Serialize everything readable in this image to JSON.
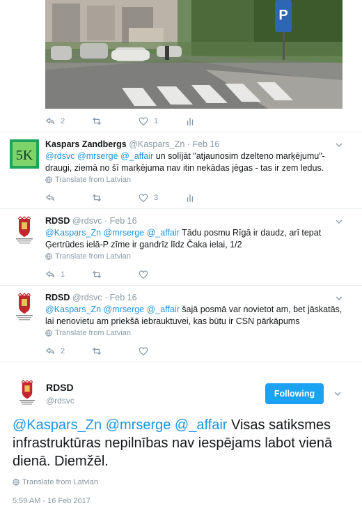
{
  "photo_tweet": {
    "reply_count": "2",
    "retweet_count": "",
    "like_count": "1"
  },
  "replies": [
    {
      "name": "Kaspars Zandbergs",
      "handle": "@Kaspars_Zn",
      "dot": "·",
      "time": "Feb 16",
      "mentions": [
        "@rdsvc",
        "@mrserge",
        "@_affair"
      ],
      "text": " un solījāt \"atjaunosim dzelteno marķējumu\"-draugi, ziemā no šī marķējuma nav itin nekādas jēgas - tas ir zem ledus.",
      "translate": "Translate from Latvian",
      "reply_count": "",
      "retweet_count": "",
      "like_count": "3",
      "avatar_text": "5K"
    },
    {
      "name": "RDSD",
      "handle": "@rdsvc",
      "dot": "·",
      "time": "Feb 16",
      "mentions": [
        "@Kaspars_Zn",
        "@mrserge",
        "@_affair"
      ],
      "text": " Tādu posmu Rīgā ir daudz, arī tepat Ģertrūdes ielā-P zīme ir gandrīz līdz Čaka ielai, 1/2",
      "translate": "Translate from Latvian",
      "reply_count": "1",
      "retweet_count": "",
      "like_count": ""
    },
    {
      "name": "RDSD",
      "handle": "@rdsvc",
      "dot": "·",
      "time": "Feb 16",
      "mentions": [
        "@Kaspars_Zn",
        "@mrserge",
        "@_affair"
      ],
      "text": "  šajā posmā var novietot am, bet jāskatās, lai nenovietu am priekšā iebrauktuvei, kas būtu ir CSN pārkāpums",
      "translate": "Translate from Latvian",
      "reply_count": "2",
      "retweet_count": "",
      "like_count": ""
    }
  ],
  "main_tweet": {
    "name": "RDSD",
    "handle": "@rdsvc",
    "follow_label": "Following",
    "mentions": [
      "@Kaspars_Zn",
      "@mrserge",
      "@_affair"
    ],
    "text": " Visas satiksmes infrastruktūras nepilnības nav iespējams labot vienā dienā. Diemžēl.",
    "translate": "Translate from Latvian",
    "timestamp": "5:59 AM - 16 Feb 2017"
  },
  "colors": {
    "accent": "#1da1f2",
    "mention": "#1b95e0",
    "muted": "#8899a6",
    "divider": "#e6ecf0"
  },
  "icons": [
    "reply-icon",
    "retweet-icon",
    "like-icon",
    "analytics-icon",
    "globe-icon",
    "chevron-down-icon",
    "parking-sign",
    "coat-of-arms-logo"
  ]
}
